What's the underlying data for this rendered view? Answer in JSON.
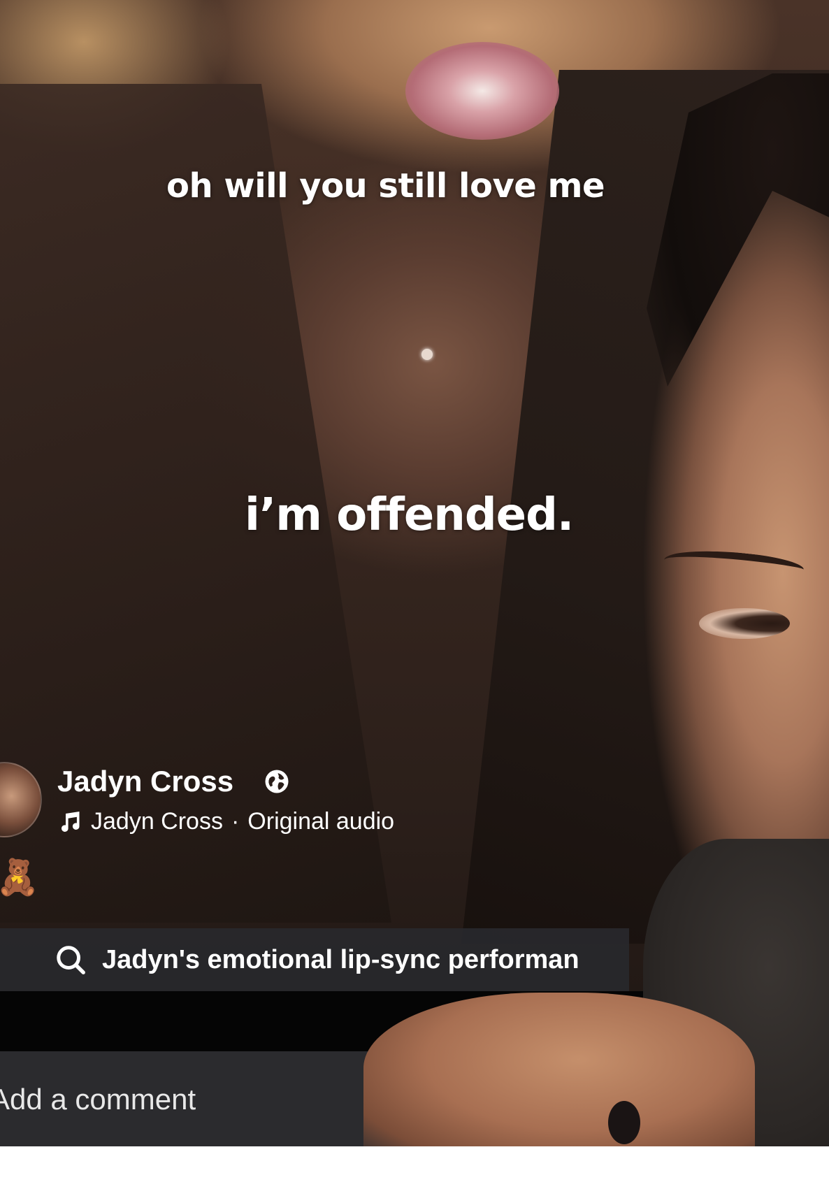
{
  "captions": {
    "line1": "oh will you still love me",
    "line2": "i’m offended."
  },
  "author": {
    "name": "Jadyn Cross",
    "audio_owner": "Jadyn Cross",
    "audio_separator": "·",
    "audio_label": "Original audio",
    "privacy_icon": "globe-icon",
    "audio_icon": "music-note-icon"
  },
  "description": {
    "emoji": "🧸"
  },
  "search": {
    "icon": "search-icon",
    "query": "Jadyn's emotional lip-sync performan"
  },
  "comment": {
    "placeholder": "Add a comment"
  },
  "colors": {
    "text": "#ffffff",
    "search_bg": "#28282c",
    "comment_bg": "#2b2b2e"
  }
}
